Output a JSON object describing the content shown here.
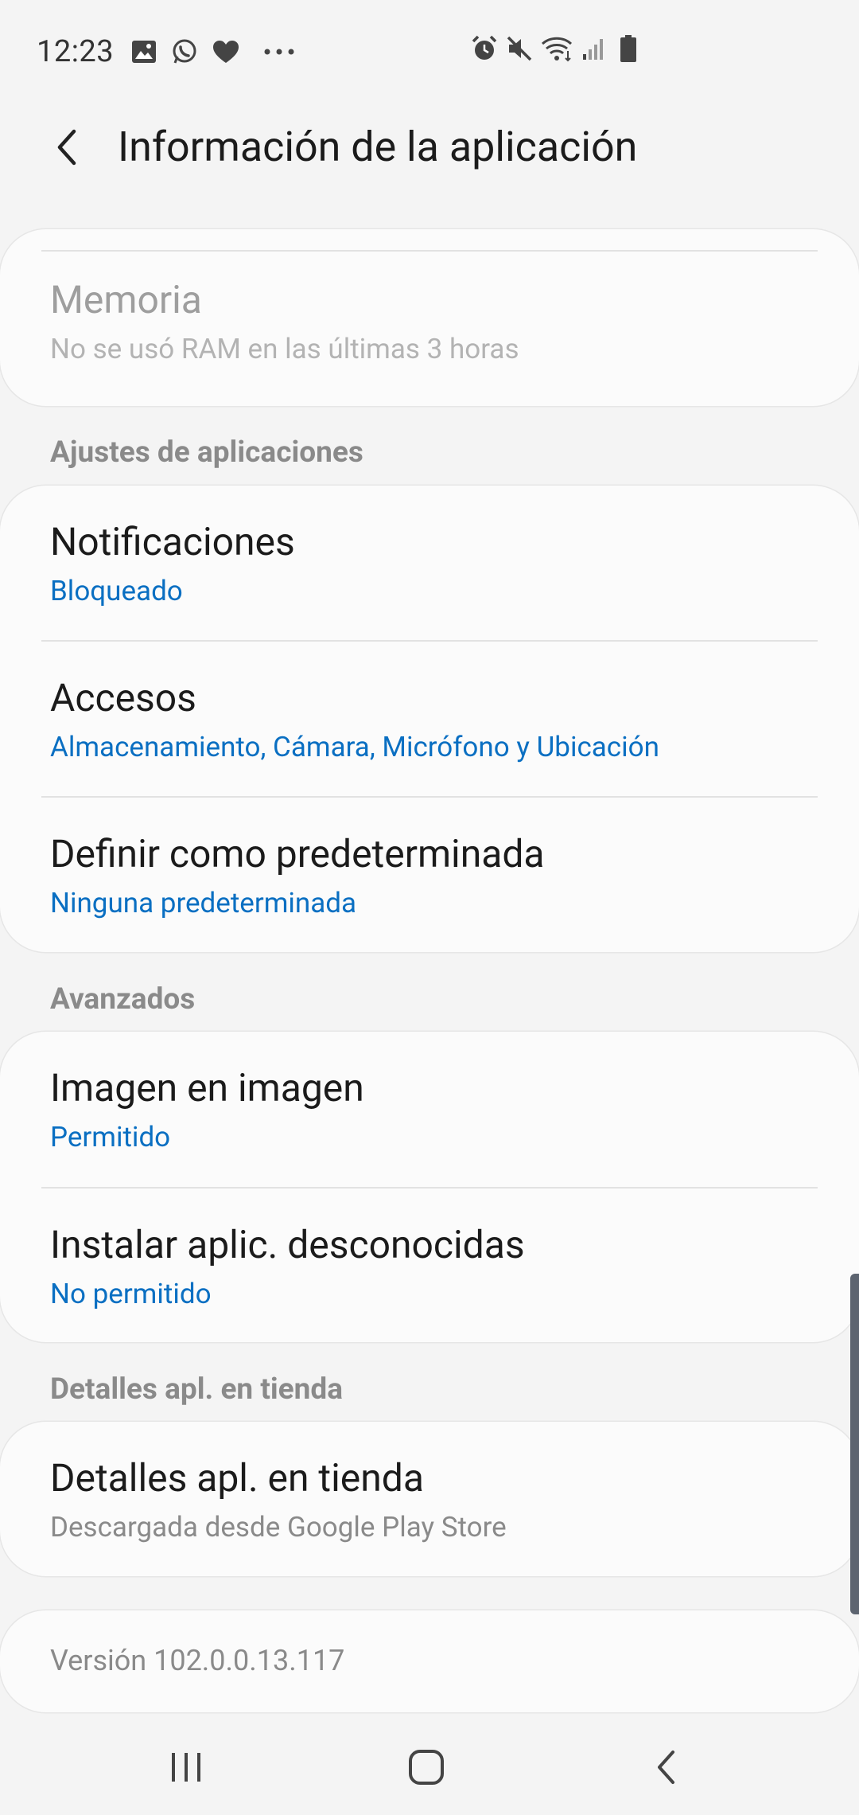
{
  "status_bar": {
    "time": "12:23",
    "left_icons": [
      "image-icon",
      "whatsapp-icon",
      "heart-icon",
      "more-dots-icon"
    ],
    "right_icons": [
      "alarm-icon",
      "mute-icon",
      "wifi-icon",
      "signal-icon",
      "battery-icon"
    ]
  },
  "header": {
    "title": "Información de la aplicación"
  },
  "memory_card": {
    "title": "Memoria",
    "subtitle": "No se usó RAM en las últimas 3 horas"
  },
  "sections": {
    "app_settings": "Ajustes de aplicaciones",
    "advanced": "Avanzados",
    "store_details": "Detalles apl. en tienda"
  },
  "app_settings": {
    "notifications": {
      "title": "Notificaciones",
      "subtitle": "Bloqueado"
    },
    "permissions": {
      "title": "Accesos",
      "subtitle": "Almacenamiento, Cámara, Micrófono y Ubicación"
    },
    "defaults": {
      "title": "Definir como predeterminada",
      "subtitle": "Ninguna predeterminada"
    }
  },
  "advanced": {
    "pip": {
      "title": "Imagen en imagen",
      "subtitle": "Permitido"
    },
    "unknown_apps": {
      "title": "Instalar aplic. desconocidas",
      "subtitle": "No permitido"
    }
  },
  "store": {
    "details": {
      "title": "Detalles apl. en tienda",
      "subtitle": "Descargada desde Google Play Store"
    }
  },
  "version": "Versión 102.0.0.13.117",
  "colors": {
    "background": "#f4f4f4",
    "card": "#fbfbfb",
    "accent": "#0a6fc2",
    "section_header": "#8a8a8a"
  }
}
